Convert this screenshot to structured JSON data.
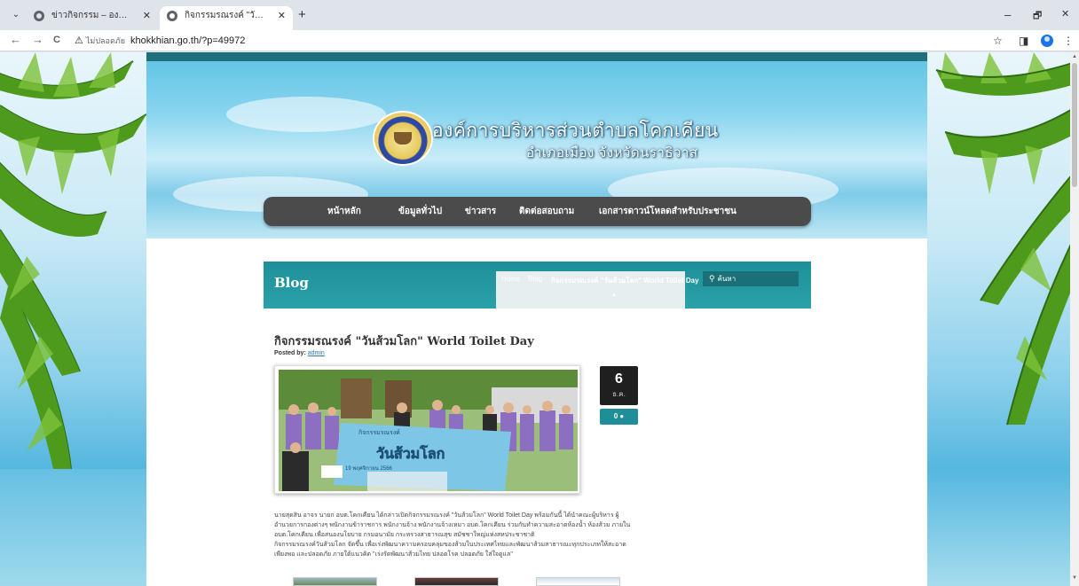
{
  "browser": {
    "tabs": [
      {
        "title": "ข่าวกิจกรรม – องค์การบริหารส่วนตำ",
        "active": false
      },
      {
        "title": "กิจกรรมรณรงค์ \"วันส้วมโลก\" World",
        "active": true
      }
    ],
    "tab_close": "✕",
    "new_tab": "+",
    "menu_icon": "⌄",
    "back": "←",
    "forward": "→",
    "reload": "C",
    "security_warning": "ไม่ปลอดภัย",
    "url": "khokkhian.go.th/?p=49972",
    "window_controls": {
      "minimize": "–",
      "restore": "🗗",
      "close": "✕"
    },
    "toolbar_icons": {
      "bookmark": "☆",
      "sidepanel": "◨",
      "menu": "⋮"
    }
  },
  "site": {
    "title": "องค์การบริหารส่วนตำบลโคกเคียน",
    "subtitle": "อำเภอเมือง  จังหวัดนราธิวาส",
    "nav": [
      "หน้าหลัก",
      "ข้อมูลทั่วไป",
      "ข่าวสาร",
      "ติดต่อสอบถาม",
      "เอกสารดาวน์โหลดสำหรับประชาชน"
    ]
  },
  "blog": {
    "heading": "Blog",
    "breadcrumb": [
      "Home",
      "Blog",
      "กิจกรรมรณรงค์ \"วันส้วมโลก\" World Toilet Day"
    ],
    "search_placeholder": "ค้นหา"
  },
  "post": {
    "title": "กิจกรรมรณรงค์ \"วันส้วมโลก\" World Toilet Day",
    "posted_by_label": "Posted by:",
    "author": "admin",
    "date_day": "6",
    "date_month": "ธ.ค.",
    "comment_count": "0",
    "banner_text": {
      "header": "กิจกรรมรณรงค์",
      "main": "วันส้วมโลก",
      "date": "19 พฤศจิกายน 2566"
    },
    "body": [
      "นายสุดสิน อาจร นายก อบต.โคกเคียน ได้กล่าวเปิดกิจกรรมรณรงค์ \"วันส้วมโลก\" World Toilet Day พร้อมกันนี้ ได้นำคณะผู้บริหาร ผู้",
      "อำนวยการกองต่างๆ พนักงานข้าราชการ พนักงานจ้าง พนักงานจ้างเหมา อบต.โคกเคียน ร่วมกันทำความสะอาดห้องน้ำ ห้องส้วม ภายใน",
      "อบต.โคกเคียน เพื่อสนองนโยบาย กรมอนามัย กระทรวงสาธารณสุข สมัชชาใหญ่แห่งสหประชาชาติ",
      "กิจกรรมรณรงค์วันส้วมโลก จัดขึ้น เพื่อเร่งพัฒนาความครอบคลุมของส้วมในประเทศไทยและพัฒนาส้วมสาธารณะทุกประเภทให้สะอาด",
      "เพียงพอ และปลอดภัย ภายใต้แนวคิด \"เร่งรัดพัฒนาส้วมไทย ปลอดโรค ปลอดภัย ใส่ใจดูแล\""
    ]
  }
}
